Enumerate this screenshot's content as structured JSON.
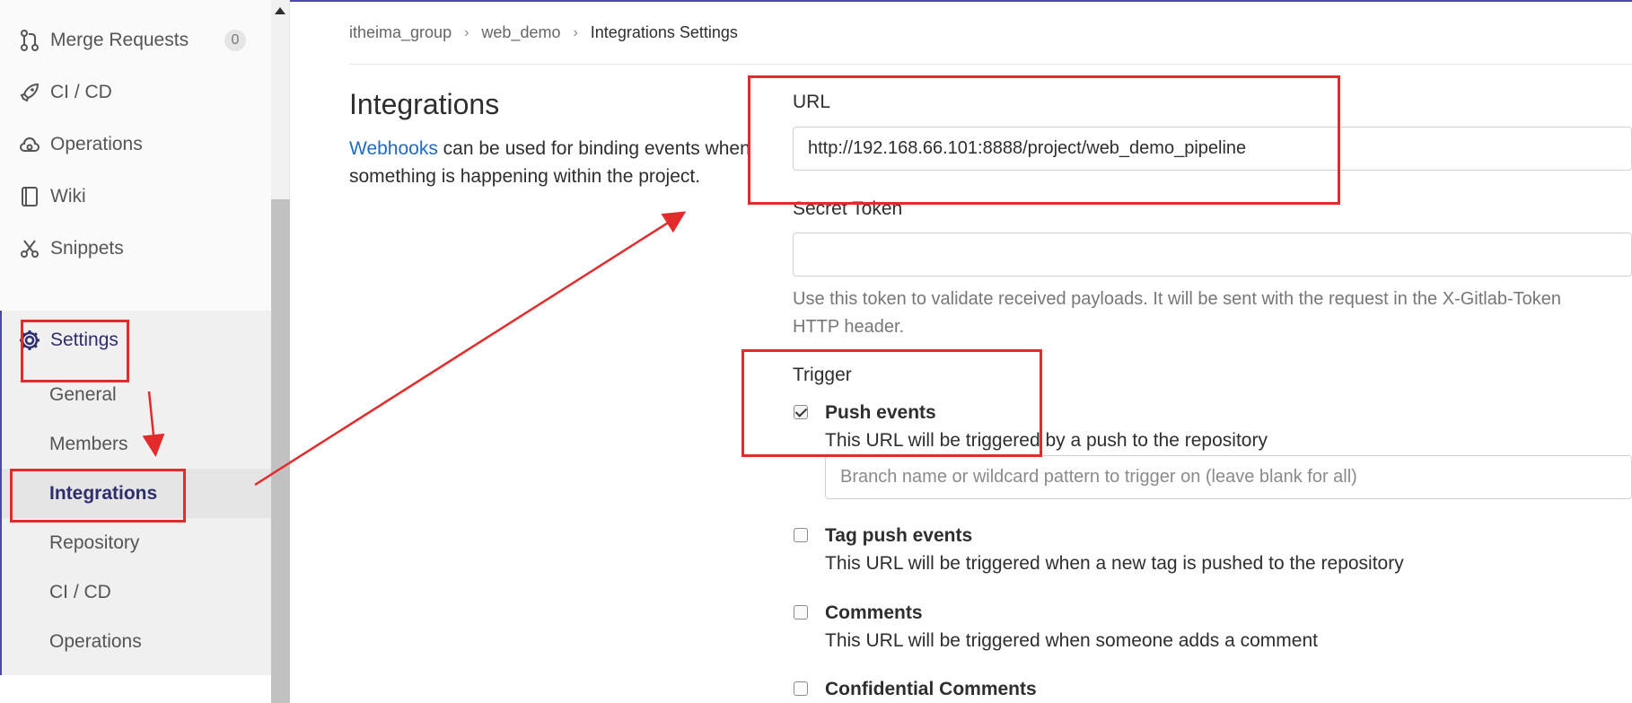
{
  "sidebar": {
    "items": [
      {
        "label": "Merge Requests",
        "icon": "merge-request-icon",
        "badge": "0"
      },
      {
        "label": "CI / CD",
        "icon": "rocket-icon"
      },
      {
        "label": "Operations",
        "icon": "cloud-gear-icon"
      },
      {
        "label": "Wiki",
        "icon": "book-icon"
      },
      {
        "label": "Snippets",
        "icon": "scissors-icon"
      },
      {
        "label": "Settings",
        "icon": "gear-icon"
      }
    ],
    "sub_items": [
      "General",
      "Members",
      "Integrations",
      "Repository",
      "CI / CD",
      "Operations"
    ]
  },
  "breadcrumb": {
    "group": "itheima_group",
    "project": "web_demo",
    "current": "Integrations Settings"
  },
  "main": {
    "title": "Integrations",
    "intro_link": "Webhooks",
    "intro_line1": " can be used for binding events when",
    "intro_line2": "something is happening within the project.",
    "url_label": "URL",
    "url_value": "http://192.168.66.101:8888/project/web_demo_pipeline",
    "secret_label": "Secret Token",
    "secret_value": "",
    "secret_help": "Use this token to validate received payloads. It will be sent with the request in the X-Gitlab-Token HTTP header.",
    "trigger_label": "Trigger",
    "triggers": [
      {
        "title": "Push events",
        "desc": "This URL will be triggered by a push to the repository",
        "checked": true
      },
      {
        "title": "Tag push events",
        "desc": "This URL will be triggered when a new tag is pushed to the repository",
        "checked": false
      },
      {
        "title": "Comments",
        "desc": "This URL will be triggered when someone adds a comment",
        "checked": false
      },
      {
        "title": "Confidential Comments",
        "desc": "",
        "checked": false
      }
    ],
    "branch_placeholder": "Branch name or wildcard pattern to trigger on (leave blank for all)"
  },
  "colors": {
    "accent": "#4b4ba3",
    "annotation": "#e32b2b",
    "link": "#1f6bc1"
  }
}
